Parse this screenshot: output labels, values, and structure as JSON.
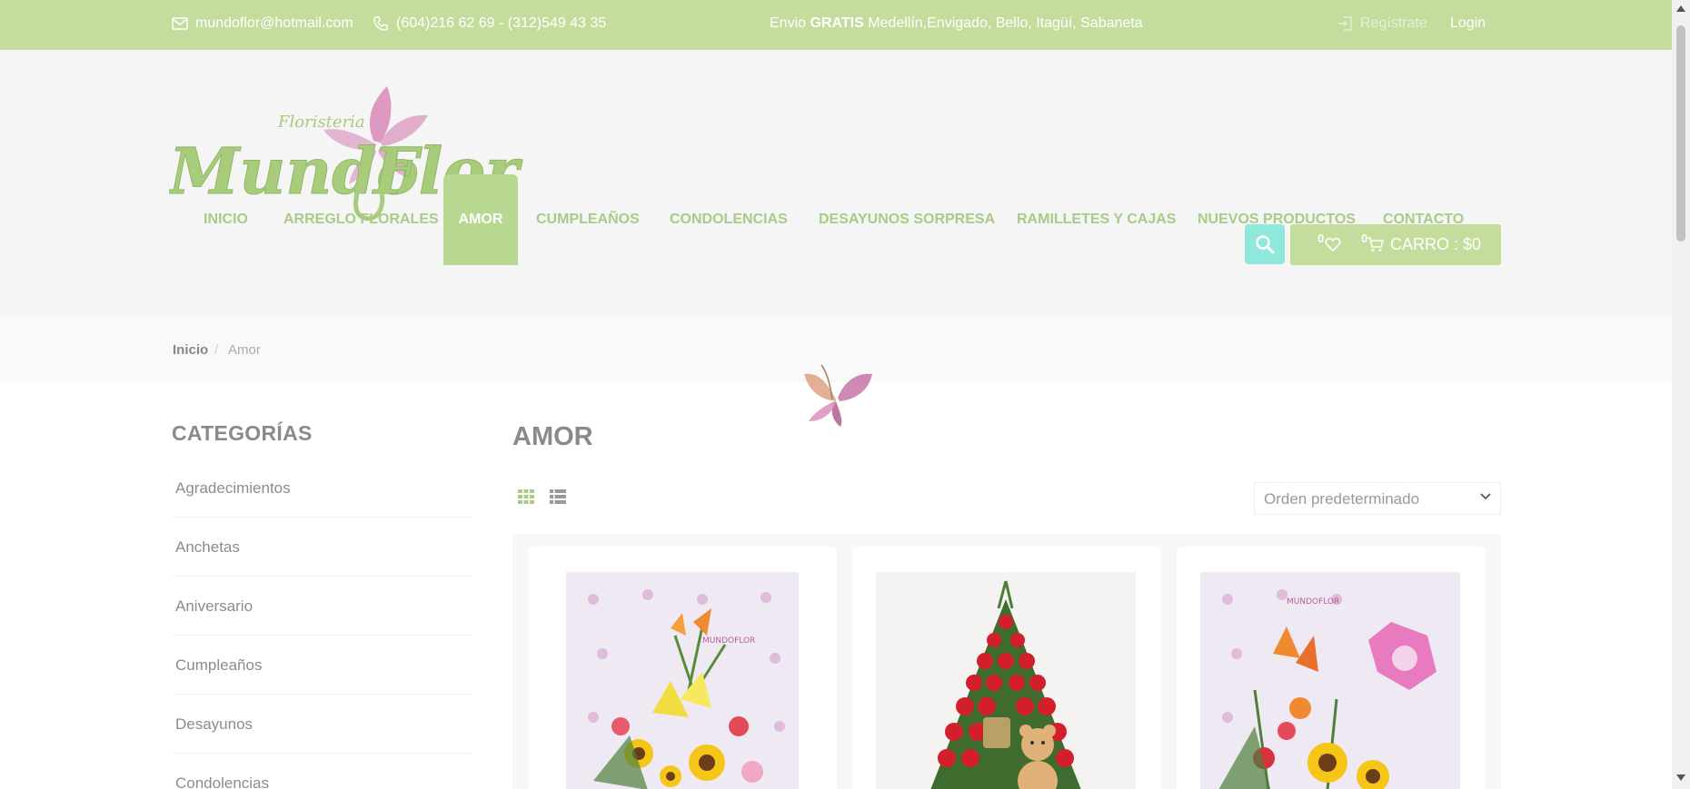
{
  "topbar": {
    "email": "mundoflor@hotmail.com",
    "phone": "(604)216 62 69 - (312)549 43 35",
    "shipping_prefix": "Envio",
    "shipping_bold": "GRATIS",
    "shipping_cities": "Medellín,Envigado, Bello, Itagüí, Sabaneta",
    "register_label": "Regístrate",
    "login_label": "Login"
  },
  "brand": {
    "logo_top_text": "Floristeria",
    "logo_text_1": "Mundo",
    "logo_text_2": "Flor",
    "logo_color": "#a8cc7c",
    "flower_color": "#d98ab8"
  },
  "nav": {
    "items": [
      {
        "label": "INICIO"
      },
      {
        "label": "ARREGLO FLORALES"
      },
      {
        "label": "AMOR"
      },
      {
        "label": "CUMPLEAÑOS"
      },
      {
        "label": "CONDOLENCIAS"
      },
      {
        "label": "DESAYUNOS SORPRESA"
      },
      {
        "label": "RAMILLETES Y CAJAS"
      },
      {
        "label": "NUEVOS PRODUCTOS"
      },
      {
        "label": "CONTACTO"
      }
    ],
    "active": "AMOR",
    "accent_color": "#a9cb87",
    "active_bg": "#b8d892"
  },
  "header_actions": {
    "search_icon": "search-icon",
    "wishlist_count": "0",
    "cart_count": "0",
    "cart_label": "CARRO : $0",
    "search_color": "#8ee8dc",
    "cart_color": "#c4dc9c"
  },
  "breadcrumb": {
    "home": "Inicio",
    "separator": "/",
    "current": "Amor"
  },
  "sidebar": {
    "title": "CATEGORÍAS",
    "categories": [
      {
        "label": "Agradecimientos"
      },
      {
        "label": "Anchetas"
      },
      {
        "label": "Aniversario"
      },
      {
        "label": "Cumpleaños"
      },
      {
        "label": "Desayunos"
      },
      {
        "label": "Condolencias"
      }
    ]
  },
  "main": {
    "title": "AMOR",
    "view_grid_icon": "grid-view-icon",
    "view_list_icon": "list-view-icon",
    "sort_selected": "Orden predeterminado"
  },
  "products": [
    {
      "name": "product-1",
      "image": "arrangement-sunflowers-lilies"
    },
    {
      "name": "product-2",
      "image": "arrangement-red-roses-teddy-bear"
    },
    {
      "name": "product-3",
      "image": "arrangement-sunflower-balloon"
    }
  ]
}
